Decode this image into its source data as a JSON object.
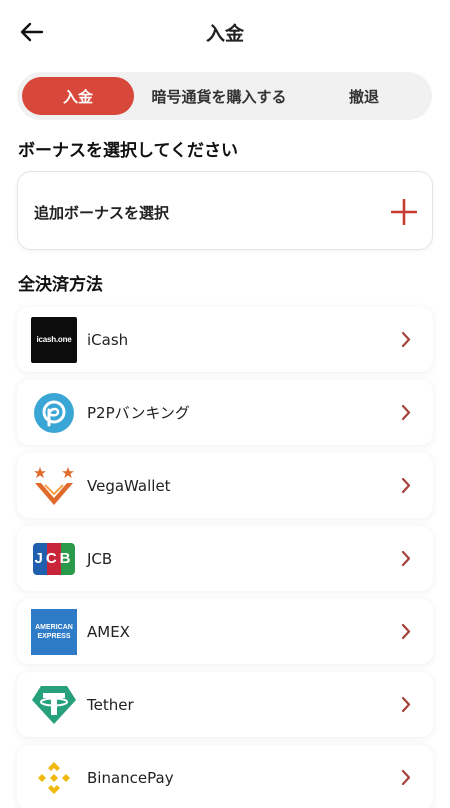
{
  "header": {
    "title": "入金",
    "back_icon": "arrow-left-icon"
  },
  "tabs": [
    {
      "label": "入金",
      "active": true
    },
    {
      "label": "暗号通貨を購入する",
      "active": false
    },
    {
      "label": "撤退",
      "active": false
    }
  ],
  "bonus": {
    "section_title": "ボーナスを選択してください",
    "select_label": "追加ボーナスを選択",
    "icon": "plus-icon"
  },
  "methods_section_title": "全決済方法",
  "methods": [
    {
      "name": "iCash",
      "icon": "icash-logo",
      "logo_text": "icash.one"
    },
    {
      "name": "P2Pバンキング",
      "icon": "p2p-logo"
    },
    {
      "name": "VegaWallet",
      "icon": "vegawallet-logo"
    },
    {
      "name": "JCB",
      "icon": "jcb-logo",
      "logo_text": "JCB"
    },
    {
      "name": "AMEX",
      "icon": "amex-logo",
      "logo_text_1": "AMERICAN",
      "logo_text_2": "EXPRESS"
    },
    {
      "name": "Tether",
      "icon": "tether-logo"
    },
    {
      "name": "BinancePay",
      "icon": "binance-logo"
    }
  ],
  "colors": {
    "accent": "#d7473a",
    "chevron": "#a4413a",
    "tab_bg": "#f1f1f1"
  }
}
